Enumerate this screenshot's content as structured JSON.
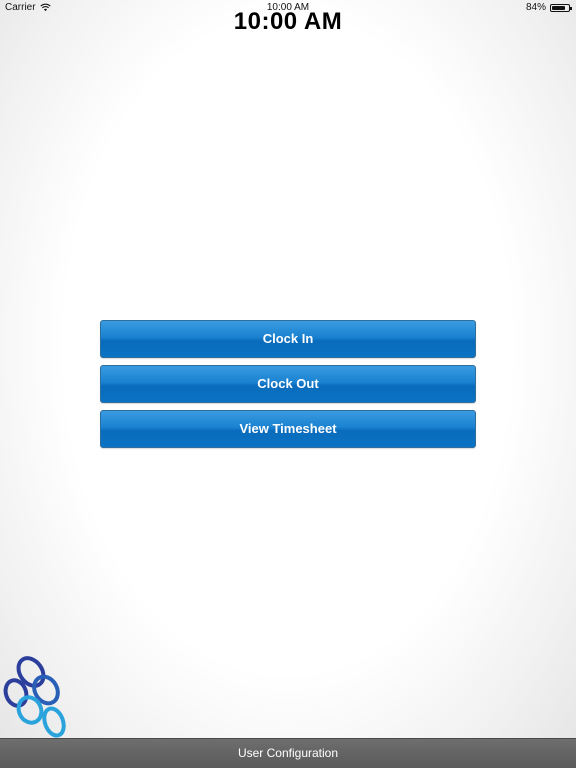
{
  "status_bar": {
    "carrier": "Carrier",
    "time": "10:00 AM",
    "battery_percent_label": "84%",
    "battery_level": 0.84,
    "wifi_icon": "wifi-icon",
    "battery_icon": "battery-icon"
  },
  "clock": {
    "time": "10:00 AM"
  },
  "actions": {
    "clock_in_label": "Clock In",
    "clock_out_label": "Clock Out",
    "view_timesheet_label": "View Timesheet"
  },
  "bottom_bar": {
    "label": "User Configuration"
  },
  "colors": {
    "button_blue": "#1a82d1",
    "logo_dark_blue": "#2c3e9c",
    "logo_light_blue": "#2aa3dc",
    "bottom_bar_gray": "#5f5f5f"
  },
  "logo": {
    "icon": "company-logo-rings"
  }
}
